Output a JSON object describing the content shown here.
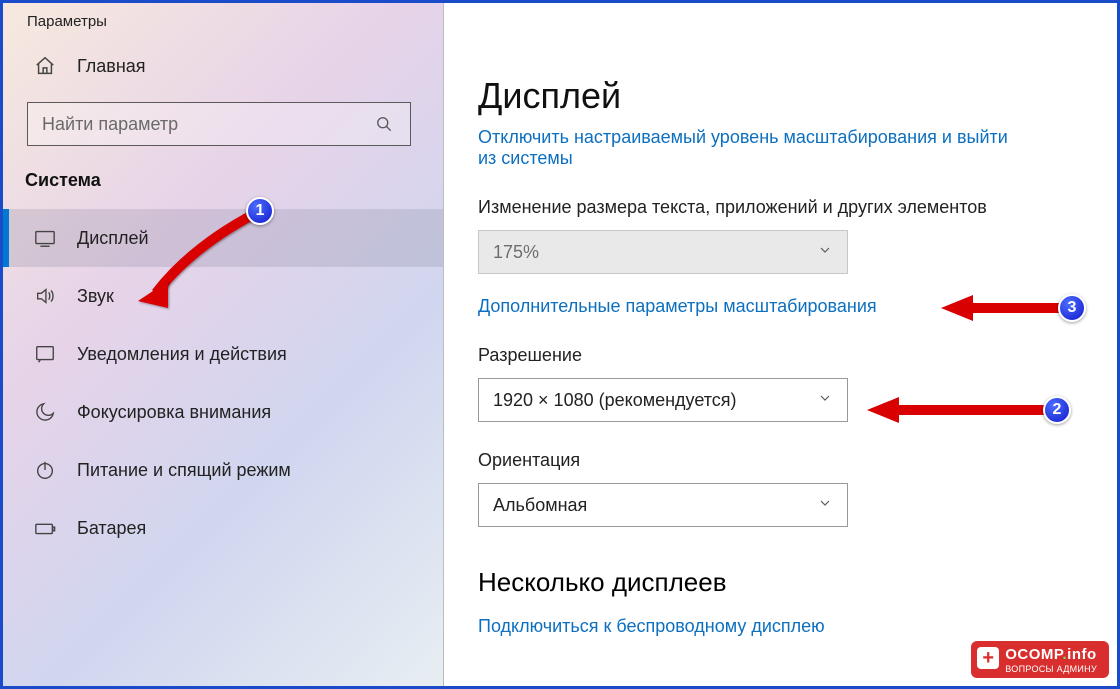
{
  "window": {
    "title": "Параметры"
  },
  "sidebar": {
    "home_label": "Главная",
    "search_placeholder": "Найти параметр",
    "category": "Система",
    "items": [
      {
        "id": "display",
        "label": "Дисплей",
        "selected": true
      },
      {
        "id": "sound",
        "label": "Звук",
        "selected": false
      },
      {
        "id": "notifications",
        "label": "Уведомления и действия",
        "selected": false
      },
      {
        "id": "focus",
        "label": "Фокусировка внимания",
        "selected": false
      },
      {
        "id": "power",
        "label": "Питание и спящий режим",
        "selected": false
      },
      {
        "id": "battery",
        "label": "Батарея",
        "selected": false
      }
    ]
  },
  "main": {
    "page_title": "Дисплей",
    "signout_link_top": "Отключить настраиваемый уровень масштабирования и выйти",
    "signout_link_bottom": "из системы",
    "scale_label": "Изменение размера текста, приложений и других элементов",
    "scale_value": "175%",
    "advanced_scaling_link": "Дополнительные параметры масштабирования",
    "resolution_label": "Разрешение",
    "resolution_value": "1920 × 1080 (рекомендуется)",
    "orientation_label": "Ориентация",
    "orientation_value": "Альбомная",
    "multi_display_header": "Несколько дисплеев",
    "connect_wireless_link": "Подключиться к беспроводному дисплею"
  },
  "annotations": {
    "badge1": "1",
    "badge2": "2",
    "badge3": "3"
  },
  "watermark": {
    "title_left": "OCOMP",
    "title_right": "info",
    "subtitle": "ВОПРОСЫ АДМИНУ"
  }
}
